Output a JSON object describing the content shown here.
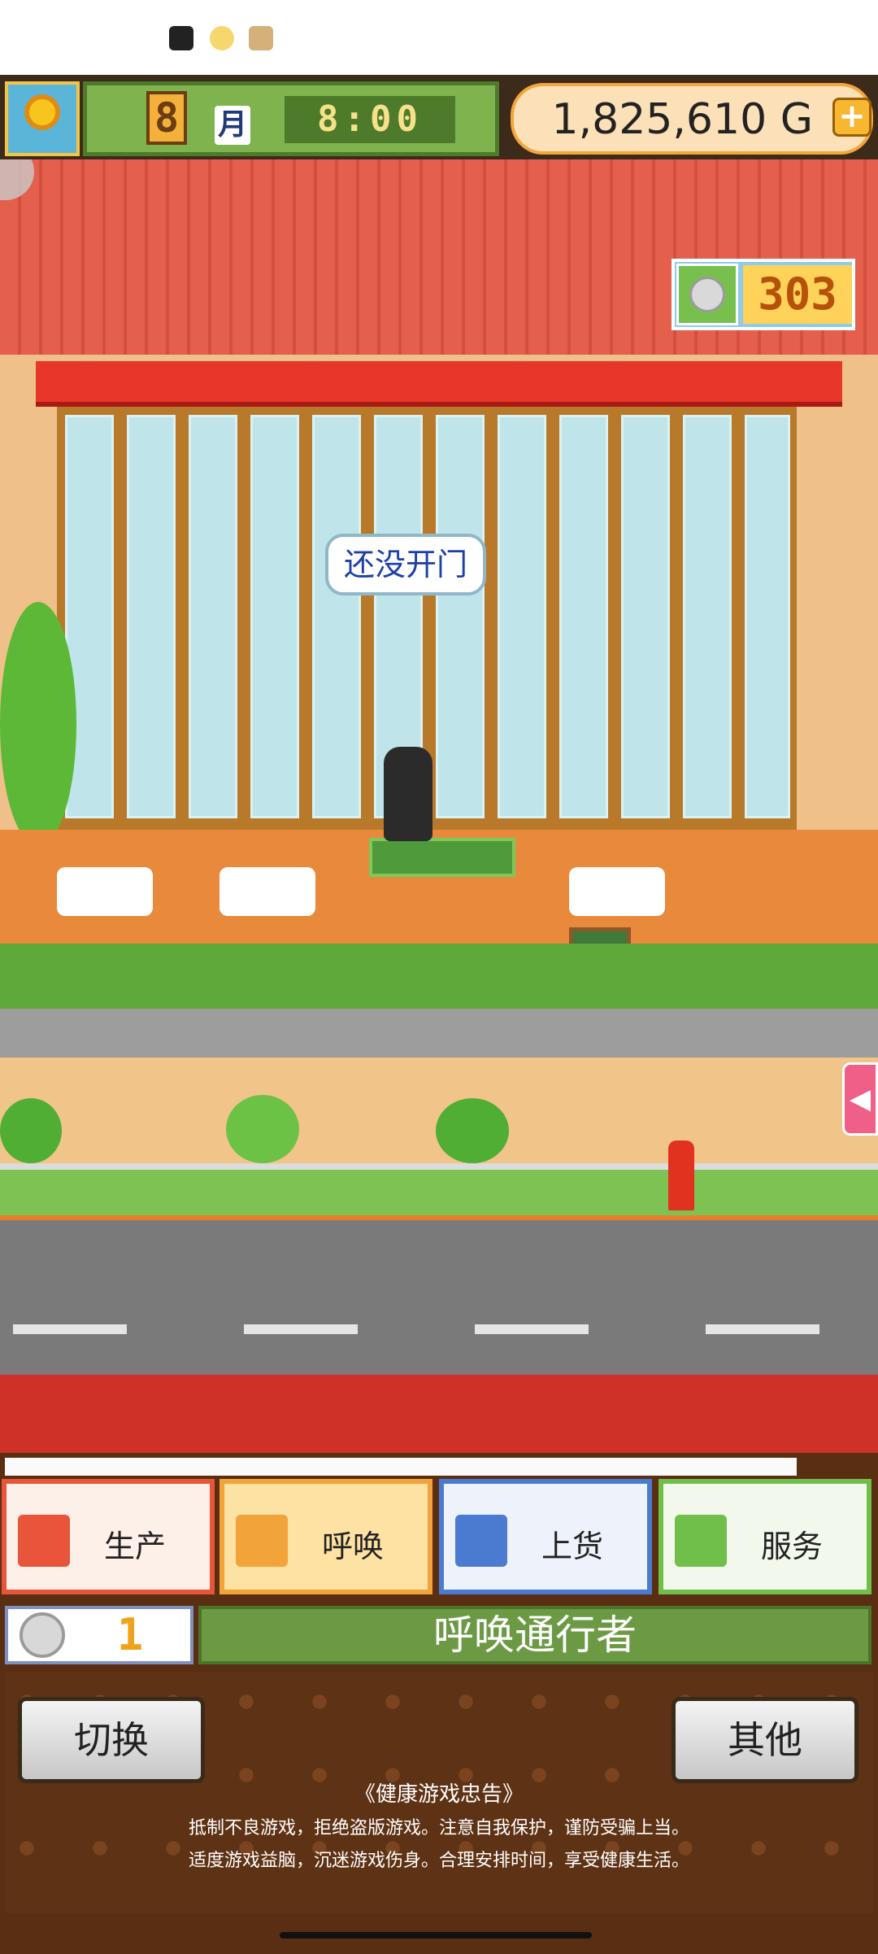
{
  "status_bar": {
    "icons": [
      "penguin-app-icon",
      "weibo-icon",
      "game-notification-icon"
    ]
  },
  "hud": {
    "season_icon": "sunflower-icon",
    "month_number": "8",
    "month_label": "月",
    "time": "8:00",
    "gold": "1,825,610 G",
    "add_gold_symbol": "+"
  },
  "scene": {
    "door_speech_bubble": "还没开门",
    "coin_count": "303",
    "side_arrow_symbol": "◀"
  },
  "menu": {
    "tabs": [
      {
        "label": "生产",
        "icon": "bread-icon",
        "color": "#e8553a"
      },
      {
        "label": "呼唤",
        "icon": "flag-icon",
        "color": "#f2a33a"
      },
      {
        "label": "上货",
        "icon": "cake-icon",
        "color": "#4a7bd1"
      },
      {
        "label": "服务",
        "icon": "coffee-cup-icon",
        "color": "#6fbf4a"
      }
    ],
    "cost_value": "1",
    "action_title": "呼唤通行者",
    "switch_button": "切换",
    "other_button": "其他"
  },
  "notice": {
    "title": "《健康游戏忠告》",
    "line1": "抵制不良游戏，拒绝盗版游戏。注意自我保护，谨防受骗上当。",
    "line2": "适度游戏益脑，沉迷游戏伤身。合理安排时间，享受健康生活。"
  }
}
